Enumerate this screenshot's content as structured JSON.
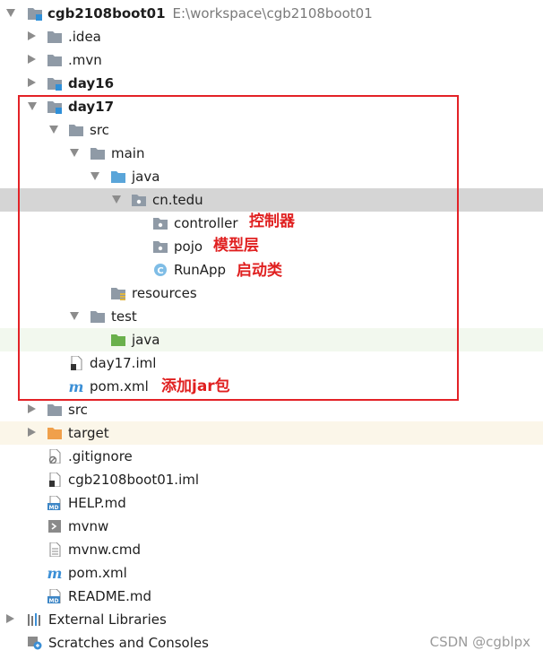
{
  "root": {
    "name": "cgb2108boot01",
    "path": "E:\\workspace\\cgb2108boot01"
  },
  "items": {
    "idea": ".idea",
    "mvn": ".mvn",
    "day16": "day16",
    "day17": "day17",
    "src": "src",
    "main": "main",
    "java": "java",
    "cn_tedu": "cn.tedu",
    "controller": "controller",
    "pojo": "pojo",
    "runapp": "RunApp",
    "resources": "resources",
    "test": "test",
    "test_java": "java",
    "day17_iml": "day17.iml",
    "day17_pom": "pom.xml",
    "root_src": "src",
    "target": "target",
    "gitignore": ".gitignore",
    "root_iml": "cgb2108boot01.iml",
    "help_md": "HELP.md",
    "mvnw": "mvnw",
    "mvnw_cmd": "mvnw.cmd",
    "root_pom": "pom.xml",
    "readme": "README.md",
    "external_libraries": "External Libraries",
    "scratches": "Scratches and Consoles"
  },
  "annotations": {
    "controller": "控制器",
    "pojo": "模型层",
    "runapp": "启动类",
    "pom": "添加jar包"
  },
  "watermark": "CSDN @cgblpx",
  "colors": {
    "folder": "#8f9aa6",
    "source_folder": "#5aa5d9",
    "test_folder": "#6ab04c",
    "excluded_folder": "#f0a04b",
    "annotation": "#e02020",
    "highlight_box": "#e32227",
    "selection": "#d5d5d5"
  },
  "icons": {
    "folder": "folder-icon",
    "module": "module-folder-icon",
    "package": "package-icon",
    "class": "class-icon",
    "resources": "resources-folder-icon",
    "maven": "maven-icon",
    "file": "file-icon",
    "markdown": "markdown-icon",
    "library": "library-icon",
    "scratches": "scratches-icon"
  }
}
